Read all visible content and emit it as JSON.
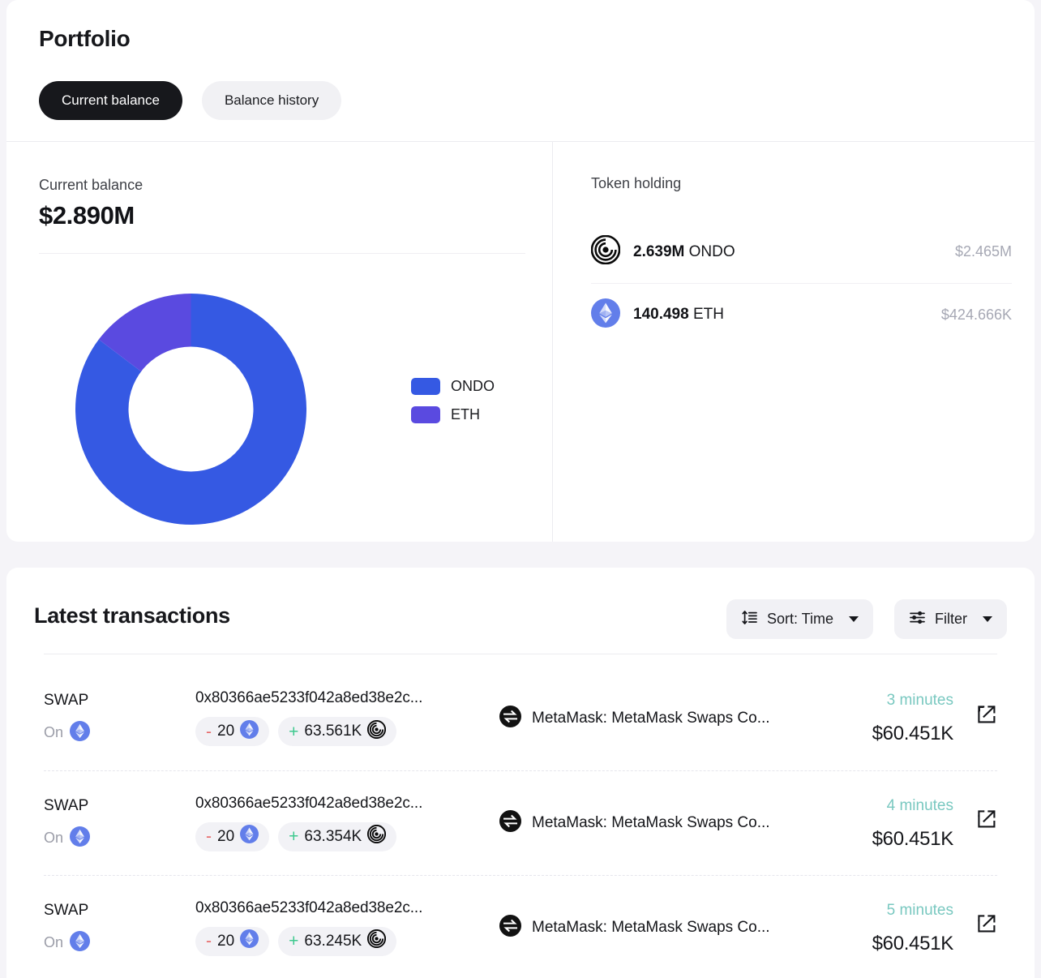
{
  "page": {
    "title": "Portfolio",
    "bg_color": "#f5f4f8",
    "card_color": "#ffffff"
  },
  "tabs": [
    {
      "label": "Current balance",
      "active": true
    },
    {
      "label": "Balance history",
      "active": false
    }
  ],
  "balance": {
    "label": "Current balance",
    "value": "$2.890M"
  },
  "chart_data": {
    "type": "pie",
    "title": "",
    "variant": "donut",
    "categories": [
      "ONDO",
      "ETH"
    ],
    "values": [
      2.465,
      0.424666
    ],
    "value_labels": [
      "$2.465M",
      "$424.666K"
    ],
    "percentages": [
      85.3,
      14.7
    ],
    "colors": [
      "#3559e3",
      "#5a4ae0"
    ],
    "legend_position": "right",
    "legend": [
      "ONDO",
      "ETH"
    ],
    "start_angle_deg": 0,
    "direction": "clockwise",
    "inner_radius_ratio": 0.54
  },
  "token_holding": {
    "title": "Token holding",
    "rows": [
      {
        "icon": "ondo-token-icon",
        "amount": "2.639M",
        "symbol": "ONDO",
        "usd": "$2.465M"
      },
      {
        "icon": "eth-token-icon",
        "amount": "140.498",
        "symbol": "ETH",
        "usd": "$424.666K"
      }
    ]
  },
  "transactions": {
    "title": "Latest transactions",
    "sort_button": {
      "label": "Sort: Time",
      "icon": "sort-icon",
      "caret": "chevron-down-icon"
    },
    "filter_button": {
      "label": "Filter",
      "icon": "filter-sliders-icon",
      "caret": "chevron-down-icon"
    },
    "rows": [
      {
        "type": "SWAP",
        "on_label": "On",
        "chain_icon": "eth-chain-icon",
        "hash": "0x80366ae5233f042a8ed38e2c...",
        "out_sign": "-",
        "out_amount": "20",
        "out_token_icon": "eth-token-icon",
        "in_sign": "+",
        "in_amount": "63.561K",
        "in_token_icon": "ondo-token-icon",
        "counterparty_icon": "metamask-swap-icon",
        "counterparty": "MetaMask: MetaMask Swaps Co...",
        "time": "3 minutes",
        "amount_usd": "$60.451K",
        "external_link_icon": "external-link-icon"
      },
      {
        "type": "SWAP",
        "on_label": "On",
        "chain_icon": "eth-chain-icon",
        "hash": "0x80366ae5233f042a8ed38e2c...",
        "out_sign": "-",
        "out_amount": "20",
        "out_token_icon": "eth-token-icon",
        "in_sign": "+",
        "in_amount": "63.354K",
        "in_token_icon": "ondo-token-icon",
        "counterparty_icon": "metamask-swap-icon",
        "counterparty": "MetaMask: MetaMask Swaps Co...",
        "time": "4 minutes",
        "amount_usd": "$60.451K",
        "external_link_icon": "external-link-icon"
      },
      {
        "type": "SWAP",
        "on_label": "On",
        "chain_icon": "eth-chain-icon",
        "hash": "0x80366ae5233f042a8ed38e2c...",
        "out_sign": "-",
        "out_amount": "20",
        "out_token_icon": "eth-token-icon",
        "in_sign": "+",
        "in_amount": "63.245K",
        "in_token_icon": "ondo-token-icon",
        "counterparty_icon": "metamask-swap-icon",
        "counterparty": "MetaMask: MetaMask Swaps Co...",
        "time": "5 minutes",
        "amount_usd": "$60.451K",
        "external_link_icon": "external-link-icon"
      }
    ]
  },
  "colors": {
    "ondo": "#3559e3",
    "eth": "#5a4ae0",
    "time_teal": "#79c8c0",
    "negative": "#e76a6a",
    "positive": "#3ec98f",
    "muted": "#a6a8b4"
  }
}
